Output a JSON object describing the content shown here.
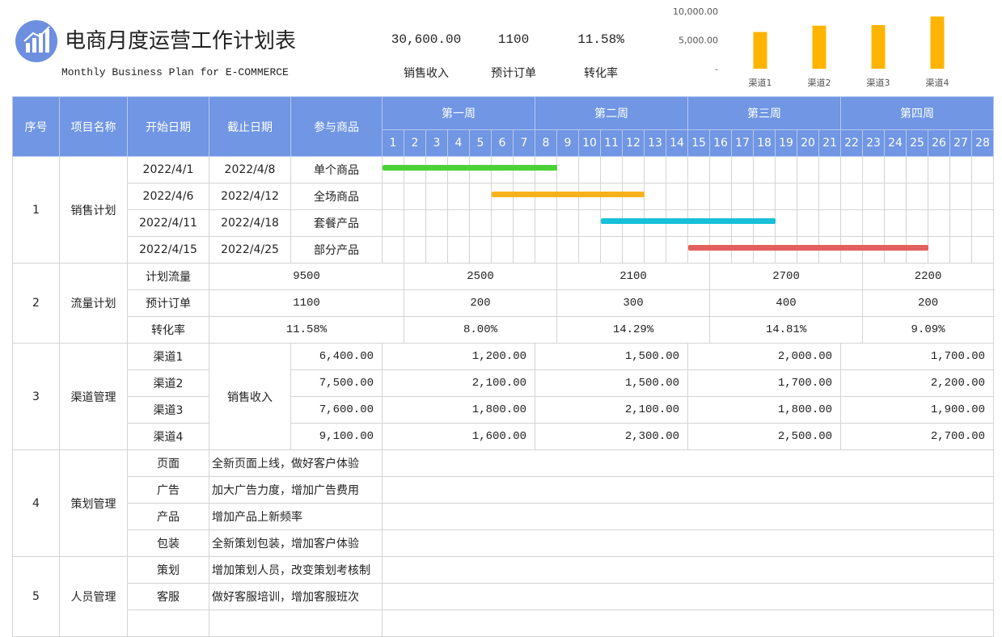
{
  "header": {
    "title": "电商月度运营工作计划表",
    "subtitle": "Monthly Business Plan for E-COMMERCE",
    "kpis": [
      {
        "value": "30,600.00",
        "label": "销售收入"
      },
      {
        "value": "1100",
        "label": "预计订单"
      },
      {
        "value": "11.58%",
        "label": "转化率"
      }
    ]
  },
  "chart_data": {
    "type": "bar",
    "categories": [
      "渠道1",
      "渠道2",
      "渠道3",
      "渠道4"
    ],
    "values": [
      6400,
      7500,
      7600,
      9100
    ],
    "ylim": [
      0,
      10000
    ],
    "yticks": [
      "10,000.00",
      "5,000.00",
      "-"
    ],
    "color": "#ffb400"
  },
  "table": {
    "col_headers": {
      "no": "序号",
      "project": "项目名称",
      "start": "开始日期",
      "end": "截止日期",
      "goods": "参与商品"
    },
    "weeks": [
      "第一周",
      "第二周",
      "第三周",
      "第四周"
    ],
    "days": [
      "1",
      "2",
      "3",
      "4",
      "5",
      "6",
      "7",
      "8",
      "9",
      "10",
      "11",
      "12",
      "13",
      "14",
      "15",
      "16",
      "17",
      "18",
      "19",
      "20",
      "21",
      "22",
      "23",
      "24",
      "25",
      "26",
      "27",
      "28"
    ],
    "sales": {
      "no": "1",
      "name": "销售计划",
      "rows": [
        {
          "start": "2022/4/1",
          "end": "2022/4/8",
          "goods": "单个商品",
          "from_day": 1,
          "to_day": 8,
          "color": "#4cd137"
        },
        {
          "start": "2022/4/6",
          "end": "2022/4/12",
          "goods": "全场商品",
          "from_day": 6,
          "to_day": 12,
          "color": "#f7b21b"
        },
        {
          "start": "2022/4/11",
          "end": "2022/4/18",
          "goods": "套餐产品",
          "from_day": 11,
          "to_day": 18,
          "color": "#17c0d8"
        },
        {
          "start": "2022/4/15",
          "end": "2022/4/25",
          "goods": "部分产品",
          "from_day": 15,
          "to_day": 25,
          "color": "#e4605e"
        }
      ]
    },
    "traffic": {
      "no": "2",
      "name": "流量计划",
      "rows": [
        {
          "label": "计划流量",
          "total": "9500",
          "weeks": [
            "2500",
            "2100",
            "2700",
            "2200"
          ]
        },
        {
          "label": "预计订单",
          "total": "1100",
          "weeks": [
            "200",
            "300",
            "400",
            "200"
          ]
        },
        {
          "label": "转化率",
          "total": "11.58%",
          "weeks": [
            "8.00%",
            "14.29%",
            "14.81%",
            "9.09%"
          ]
        }
      ]
    },
    "channels": {
      "no": "3",
      "name": "渠道管理",
      "metric": "销售收入",
      "rows": [
        {
          "label": "渠道1",
          "total": "6,400.00",
          "weeks": [
            "1,200.00",
            "1,500.00",
            "2,000.00",
            "1,700.00"
          ]
        },
        {
          "label": "渠道2",
          "total": "7,500.00",
          "weeks": [
            "2,100.00",
            "1,500.00",
            "1,700.00",
            "2,200.00"
          ]
        },
        {
          "label": "渠道3",
          "total": "7,600.00",
          "weeks": [
            "1,800.00",
            "2,100.00",
            "1,800.00",
            "1,900.00"
          ]
        },
        {
          "label": "渠道4",
          "total": "9,100.00",
          "weeks": [
            "1,600.00",
            "2,300.00",
            "2,500.00",
            "2,700.00"
          ]
        }
      ]
    },
    "planning": {
      "no": "4",
      "name": "策划管理",
      "rows": [
        {
          "label": "页面",
          "text": "全新页面上线，做好客户体验"
        },
        {
          "label": "广告",
          "text": "加大广告力度，增加广告费用"
        },
        {
          "label": "产品",
          "text": "增加产品上新频率"
        },
        {
          "label": "包装",
          "text": "全新策划包装，增加客户体验"
        }
      ]
    },
    "staff": {
      "no": "5",
      "name": "人员管理",
      "rows": [
        {
          "label": "策划",
          "text": "增加策划人员，改变策划考核制"
        },
        {
          "label": "客服",
          "text": "做好客服培训，增加客服班次"
        },
        {
          "label": "",
          "text": ""
        }
      ]
    }
  }
}
